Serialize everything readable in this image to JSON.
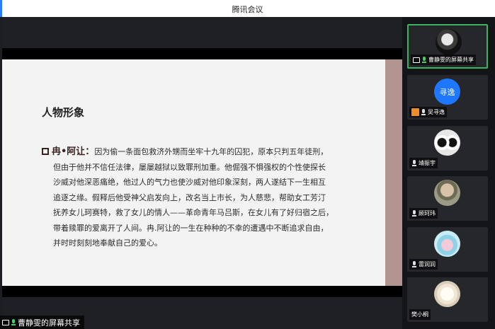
{
  "app": {
    "title": "腾讯会议"
  },
  "slide": {
    "heading": "人物形象",
    "lead": "冉•阿让：",
    "lines": [
      "因为偷一条面包救济外甥而坐牢十九年的囚犯，原本只判五年徒刑，",
      "但由于他并不信任法律，屡屡越狱以致罪刑加重。他倔强不惧强权的个性使探长",
      "沙威对他深恶痛绝，他过人的气力也使沙威对他印象深刻，两人遂结下一生相互",
      "追逐之缘。假释后他受神父启发向上，改名当上市长，为人慈悲，帮助女工芳汀",
      "抚养女儿珂赛特，救了女儿的情人——革命青年马吕斯，在女儿有了好归宿之后，",
      "带着赎罪的爱离开了人间。冉.阿让的一生在种种的不幸的遭遇中不断追求自由，",
      "并时时刻刻地奉献自己的爱心。"
    ]
  },
  "share_label": "曹静雯的屏幕共享",
  "participants": [
    {
      "name": "曹静雯的屏幕共享",
      "avatar": "photo-avatar-dark",
      "mic": "on",
      "screen_share": true,
      "active": true
    },
    {
      "name": "吴寻逸",
      "avatar_text": "寻逸",
      "avatar_color": "#1e78ff",
      "mic": "off",
      "badge": "orange"
    },
    {
      "name": "靖振宇",
      "avatar": "cartoon-avatar",
      "mic": "off"
    },
    {
      "name": "顾珂玮",
      "avatar": "photo-avatar",
      "mic": "off"
    },
    {
      "name": "雷润润",
      "avatar": "anime-avatar",
      "mic": "off"
    },
    {
      "name": "樊小桐",
      "avatar": "pet-avatar",
      "mic": "none"
    }
  ],
  "colors": {
    "active_border": "#3fb160",
    "mic_on": "#3fd06a",
    "accent": "#2a7cff",
    "slide_band": "#b39590"
  }
}
